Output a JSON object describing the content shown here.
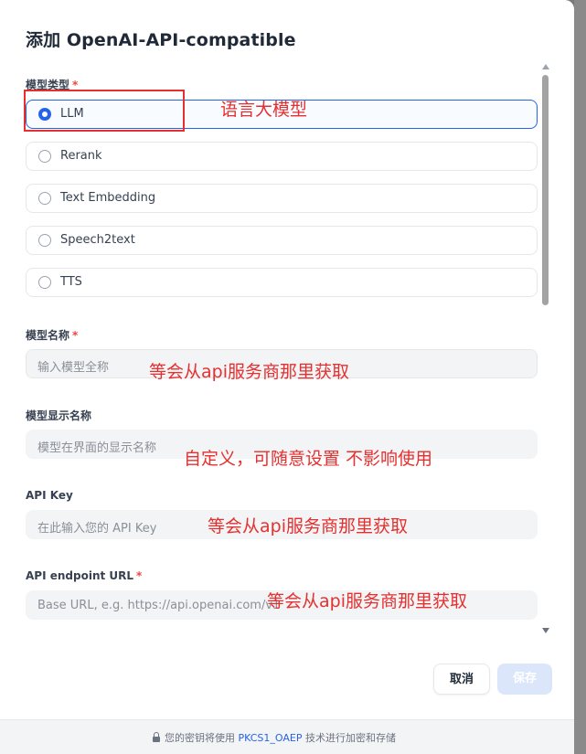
{
  "dialog": {
    "title": "添加 OpenAI-API-compatible"
  },
  "model_type": {
    "label": "模型类型",
    "required_mark": "*",
    "options": [
      {
        "label": "LLM",
        "selected": true
      },
      {
        "label": "Rerank",
        "selected": false
      },
      {
        "label": "Text Embedding",
        "selected": false
      },
      {
        "label": "Speech2text",
        "selected": false
      },
      {
        "label": "TTS",
        "selected": false
      }
    ]
  },
  "model_name": {
    "label": "模型名称",
    "required_mark": "*",
    "placeholder": "输入模型全称"
  },
  "display_name": {
    "label": "模型显示名称",
    "placeholder": "模型在界面的显示名称"
  },
  "api_key": {
    "label": "API Key",
    "placeholder": "在此输入您的 API Key"
  },
  "endpoint": {
    "label": "API endpoint URL",
    "required_mark": "*",
    "placeholder": "Base URL, e.g. https://api.openai.com/v1"
  },
  "buttons": {
    "cancel": "取消",
    "save": "保存"
  },
  "footer": {
    "prefix": "您的密钥将使用",
    "link": "PKCS1_OAEP",
    "suffix": "技术进行加密和存储"
  },
  "annotations": {
    "llm_note": "语言大模型",
    "model_name_note": "等会从api服务商那里获取",
    "display_name_note": "自定义，可随意设置 不影响使用",
    "api_key_note": "等会从api服务商那里获取",
    "endpoint_note": "等会从api服务商那里获取"
  },
  "colors": {
    "accent": "#2563eb",
    "annotation": "#e5302f",
    "required": "#ef4444"
  }
}
